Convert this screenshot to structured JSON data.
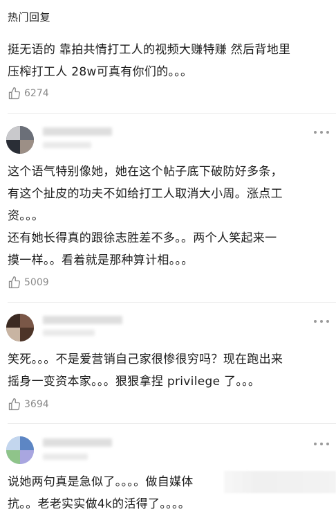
{
  "section": {
    "title": "热门回复"
  },
  "icons": {
    "like": "thumbs-up-icon",
    "more": "more-dots-icon",
    "avatar": "user-avatar"
  },
  "comments": [
    {
      "lines": [
        "挺无语的 靠拍共情打工人的视频大赚特赚 然后背地里",
        "压榨打工人 28w可真有你们的。。。"
      ],
      "likes": "6274"
    },
    {
      "lines": [
        "这个语气特别像她，她在这个帖子底下破防好多条，",
        "有这个扯皮的功夫不如给打工人取消大小周。涨点工",
        "资。。。",
        "还有她长得真的跟徐志胜差不多。。两个人笑起来一",
        "摸一样。。看着就是那种算计相。。。"
      ],
      "likes": "5009"
    },
    {
      "lines": [
        "笑死。。。不是爱营销自己家很惨很穷吗？现在跑出来",
        "摇身一变资本家。。。狠狠拿捏 privilege 了。。。"
      ],
      "likes": "3694"
    },
    {
      "lines": [
        "说她两句真是急似了。。。。做自媒体",
        "抗。。老老实实做4k的活得了。。。。"
      ],
      "likes": ""
    }
  ]
}
